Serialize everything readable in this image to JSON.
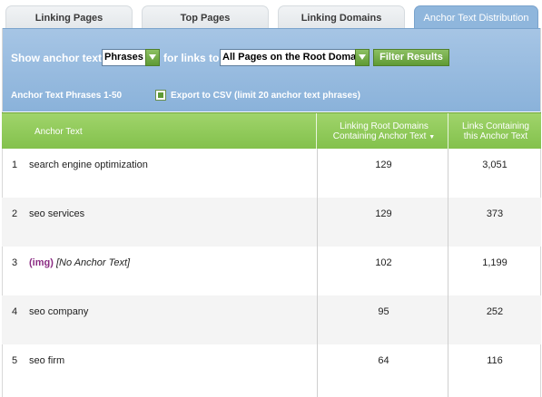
{
  "tabs": [
    {
      "label": "Linking Pages"
    },
    {
      "label": "Top Pages"
    },
    {
      "label": "Linking Domains"
    },
    {
      "label": "Anchor Text Distribution",
      "active": true
    }
  ],
  "filter": {
    "show_label": "Show anchor text",
    "type_select": "Phrases",
    "for_label": "for links to",
    "pages_select": "All Pages on the Root Domain",
    "filter_button": "Filter Results",
    "range_label": "Anchor Text Phrases 1-50",
    "export_link": "Export to CSV (limit 20 anchor text phrases)"
  },
  "table": {
    "headers": {
      "anchor": "Anchor Text",
      "root_domains_line1": "Linking Root Domains",
      "root_domains_line2": "Containing Anchor Text",
      "sort_indicator": "▼",
      "links_line1": "Links Containing",
      "links_line2": "this Anchor Text"
    },
    "rows": [
      {
        "num": "1",
        "text": "search engine optimization",
        "root_domains": "129",
        "links": "3,051"
      },
      {
        "num": "2",
        "text": "seo services",
        "root_domains": "129",
        "links": "373"
      },
      {
        "num": "3",
        "img_tag": "(img)",
        "text": "[No Anchor Text]",
        "root_domains": "102",
        "links": "1,199"
      },
      {
        "num": "4",
        "text": "seo company",
        "root_domains": "95",
        "links": "252"
      },
      {
        "num": "5",
        "text": "seo firm",
        "root_domains": "64",
        "links": "116"
      }
    ]
  },
  "colors": {
    "tab_active": "#8fb6dc",
    "panel": "#9bbde0",
    "header_green": "#8fca57",
    "img_tag": "#8b2c83"
  }
}
